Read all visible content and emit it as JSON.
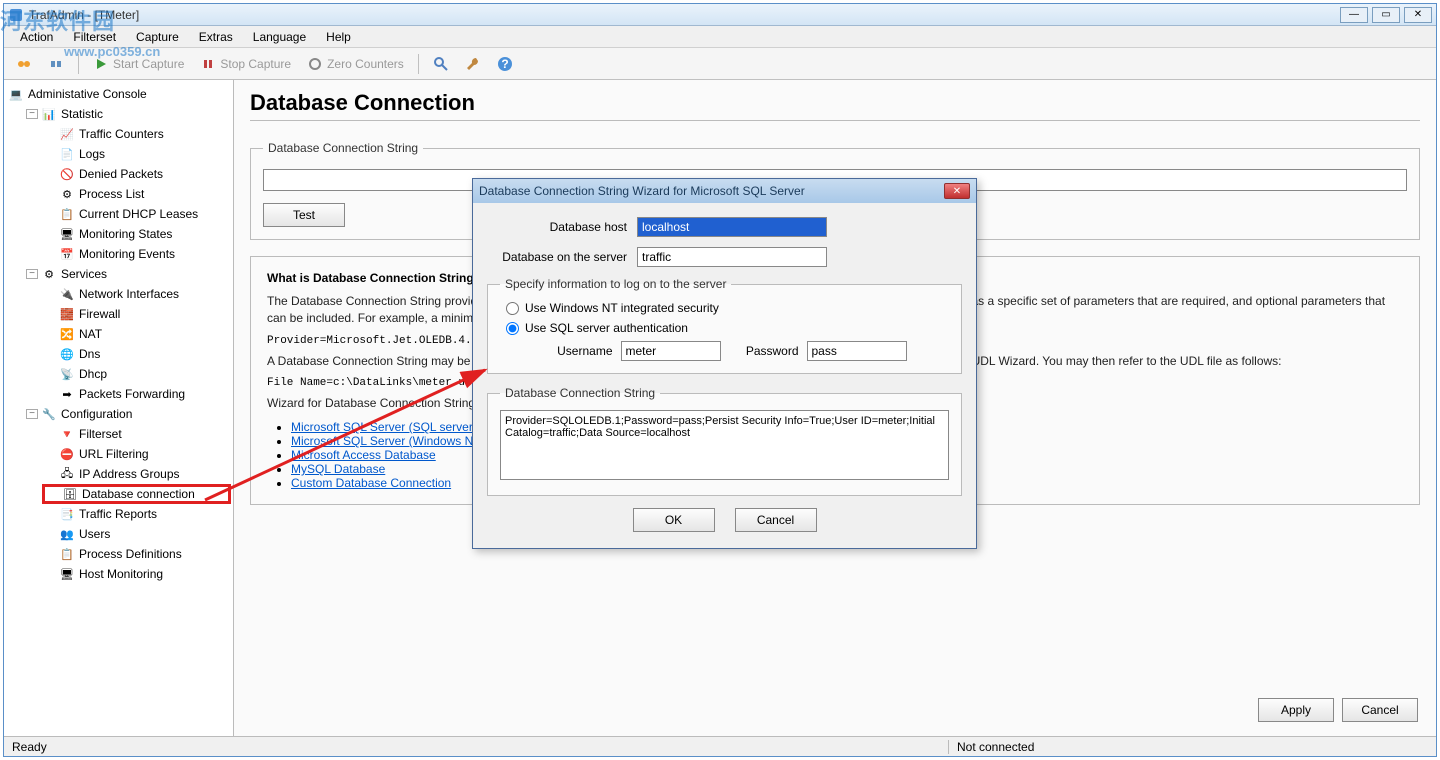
{
  "window": {
    "title": "TrafAdmin - [TMeter]"
  },
  "menu": [
    "Action",
    "Filterset",
    "Capture",
    "Extras",
    "Language",
    "Help"
  ],
  "toolbar": {
    "start": "Start Capture",
    "stop": "Stop Capture",
    "zero": "Zero Counters"
  },
  "tree": {
    "root": "Administative Console",
    "statistic": "Statistic",
    "stat_items": [
      "Traffic Counters",
      "Logs",
      "Denied Packets",
      "Process List",
      "Current DHCP Leases",
      "Monitoring States",
      "Monitoring Events"
    ],
    "services": "Services",
    "svc_items": [
      "Network Interfaces",
      "Firewall",
      "NAT",
      "Dns",
      "Dhcp",
      "Packets Forwarding"
    ],
    "config": "Configuration",
    "cfg_items": [
      "Filterset",
      "URL Filtering",
      "IP Address Groups",
      "Database connection",
      "Traffic Reports",
      "Users",
      "Process Definitions",
      "Host Monitoring"
    ]
  },
  "page": {
    "heading": "Database Connection",
    "fs_legend": "Database Connection String",
    "test": "Test",
    "info_h": "What is Database Connection String",
    "info_p1": "The Database Connection String provides the information needed to establish a connection with the database. Each database type has a specific set of parameters that are required, and optional parameters that can be included. For example, a minimal connection string example might be:",
    "info_mono1": "Provider=Microsoft.Jet.OLEDB.4.0;",
    "info_p2": "A Database Connection String may be stored in a separate file (UDL - Microsoft Data Link file, .udl, and may be created by using the UDL Wizard. You may then refer to the UDL file as follows:",
    "info_mono2": "File Name=c:\\DataLinks\\meter.udl",
    "info_p3": "Wizard for Database Connection String:",
    "links": [
      "Microsoft SQL Server (SQL server authentication)",
      "Microsoft SQL Server (Windows NT integrated security)",
      "Microsoft Access Database",
      "MySQL Database",
      "Custom Database Connection"
    ],
    "apply": "Apply",
    "cancel": "Cancel"
  },
  "dialog": {
    "title": "Database Connection String Wizard for Microsoft SQL Server",
    "host_label": "Database host",
    "host_value": "localhost",
    "db_label": "Database on the server",
    "db_value": "traffic",
    "auth_legend": "Specify information to log on to the server",
    "radio1": "Use Windows NT integrated security",
    "radio2": "Use SQL server authentication",
    "user_label": "Username",
    "user_value": "meter",
    "pass_label": "Password",
    "pass_value": "pass",
    "cs_legend": "Database Connection String",
    "cs_value": "Provider=SQLOLEDB.1;Password=pass;Persist Security Info=True;User ID=meter;Initial Catalog=traffic;Data Source=localhost",
    "ok": "OK",
    "cancel": "Cancel"
  },
  "status": {
    "left": "Ready",
    "right": "Not connected"
  },
  "watermark": {
    "t1": "河东软件园",
    "t2": "www.pc0359.cn"
  }
}
